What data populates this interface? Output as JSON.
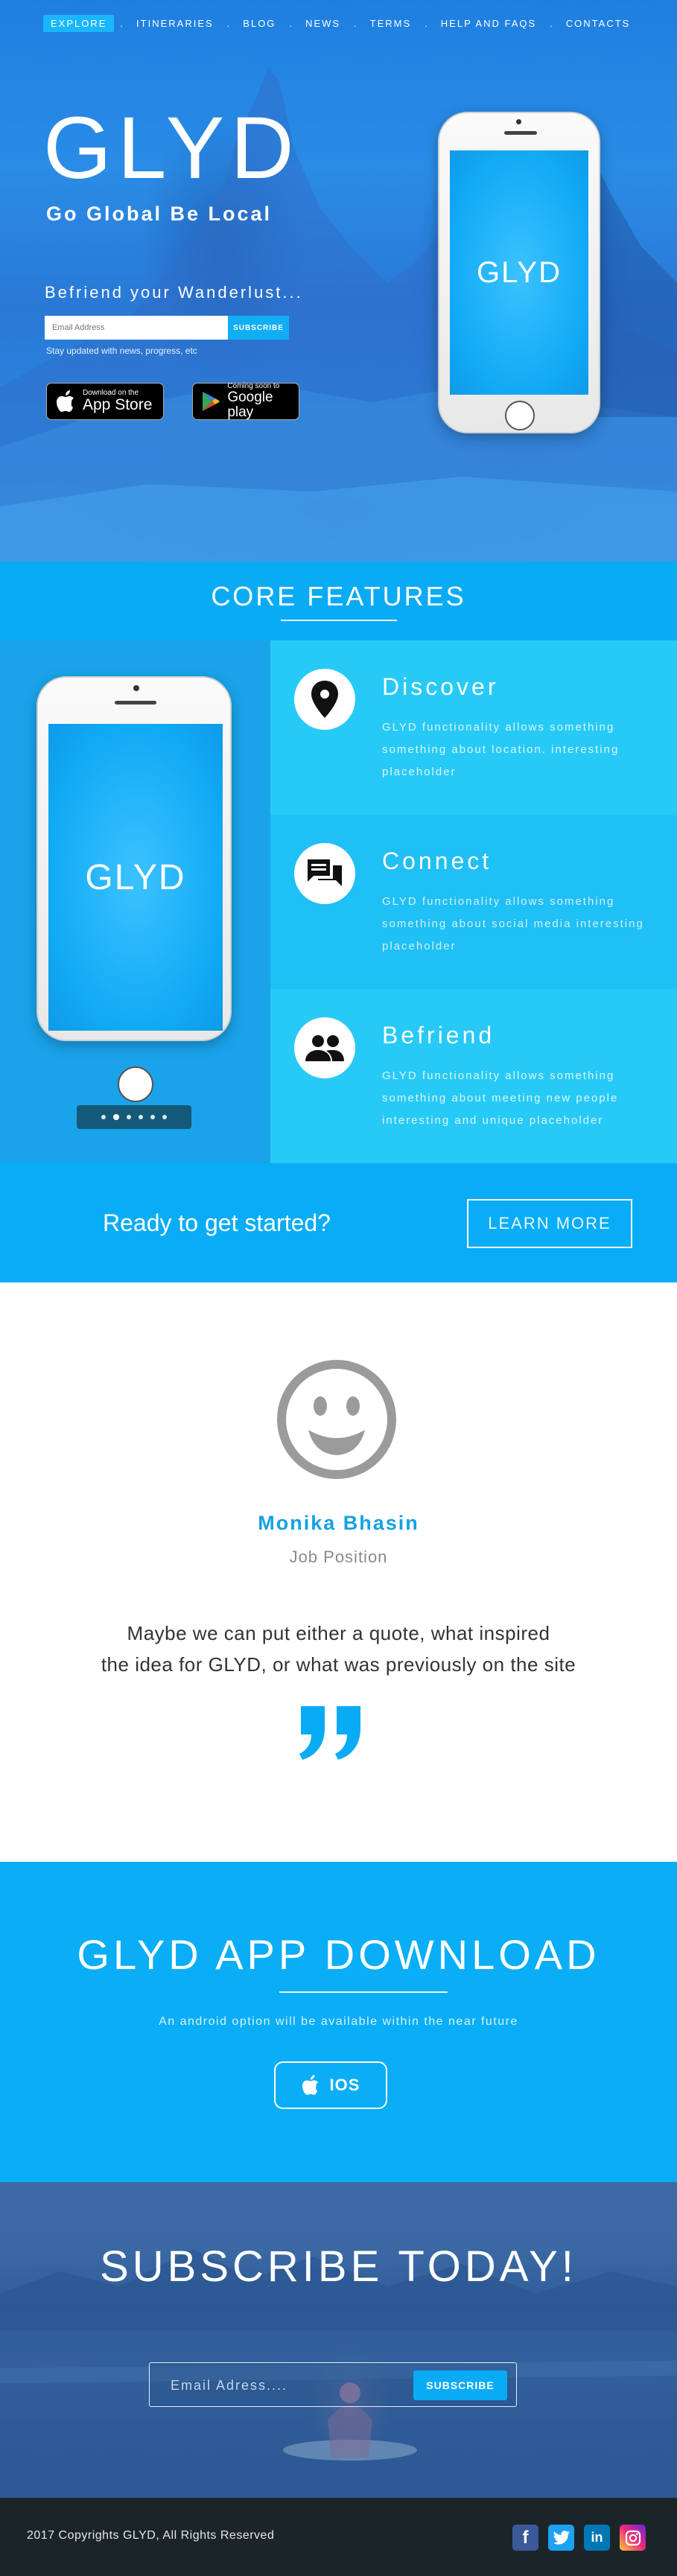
{
  "nav": {
    "items": [
      {
        "label": "EXPLORE",
        "active": true
      },
      {
        "label": "ITINERARIES",
        "active": false
      },
      {
        "label": "BLOG",
        "active": false
      },
      {
        "label": "NEWS",
        "active": false
      },
      {
        "label": "TERMS",
        "active": false
      },
      {
        "label": "HELP AND FAQS",
        "active": false
      },
      {
        "label": "CONTACTS",
        "active": false
      }
    ],
    "separator": "."
  },
  "hero": {
    "logo": "GLYD",
    "tagline": "Go Global Be Local",
    "befriend": "Befriend your Wanderlust...",
    "email_placeholder": "Email Address",
    "subscribe_label": "SUBSCRIBE",
    "note": "Stay updated with news, progress, etc",
    "app_store": {
      "small": "Download on the",
      "big": "App Store"
    },
    "google_play": {
      "small": "Coming soon to",
      "big": "Google play"
    },
    "phone_text": "GLYD"
  },
  "core": {
    "title": "CORE FEATURES",
    "phone_text": "GLYD",
    "carousel": {
      "count": 6,
      "active_index": 1
    },
    "features": [
      {
        "title": "Discover",
        "icon": "location-pin-icon",
        "desc": "GLYD functionality allows something something about location. interesting placeholder"
      },
      {
        "title": "Connect",
        "icon": "chat-icon",
        "desc": "GLYD functionality allows something something about social media interesting placeholder"
      },
      {
        "title": "Befriend",
        "icon": "people-icon",
        "desc": "GLYD functionality allows something something about meeting new people interesting and unique placeholder"
      }
    ]
  },
  "cta": {
    "text": "Ready to get started?",
    "button": "LEARN MORE"
  },
  "testimonial": {
    "avatar_icon": "smiley-avatar-icon",
    "name": "Monika Bhasin",
    "role": "Job Position",
    "quote_line1": "Maybe we can put either a quote, what inspired",
    "quote_line2": "the idea for GLYD, or what was previously on the site",
    "quote_icon": "quote-mark-icon"
  },
  "download": {
    "title": "GLYD APP DOWNLOAD",
    "note": "An android option will be available within the near future",
    "ios_label": "IOS"
  },
  "subscribe": {
    "title": "SUBSCRIBE TODAY!",
    "placeholder": "Email Adress....",
    "button": "SUBSCRIBE"
  },
  "footer": {
    "copyright": "2017 Copyrights GLYD, All Rights Reserved",
    "social": [
      {
        "name": "facebook",
        "icon": "facebook-icon",
        "glyph": "f"
      },
      {
        "name": "twitter",
        "icon": "twitter-icon"
      },
      {
        "name": "linkedin",
        "icon": "linkedin-icon",
        "glyph": "in"
      },
      {
        "name": "instagram",
        "icon": "instagram-icon"
      }
    ]
  },
  "colors": {
    "accent": "#0aabf5",
    "feature_panel": "#27caf6",
    "footer_bg": "#1b2529",
    "name_blue": "#14a2e4"
  }
}
